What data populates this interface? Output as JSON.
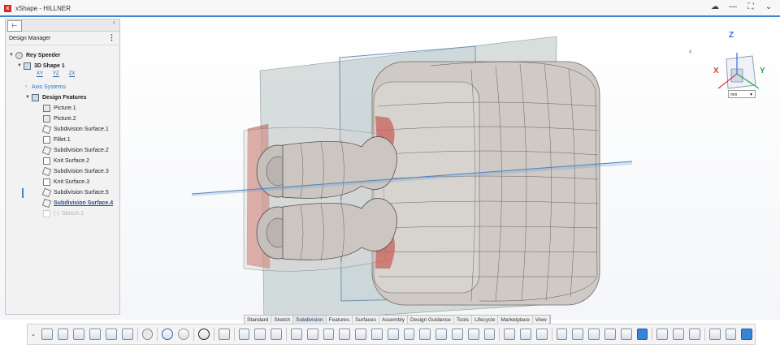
{
  "window": {
    "title": "xShape - HILLNER",
    "controls": {
      "cloud": "☁",
      "minimize": "—",
      "maximize": "⛶",
      "menu": "⌄"
    }
  },
  "panel": {
    "title": "Design Manager",
    "collapse_label": "‹",
    "menu_label": "⋮"
  },
  "tree": {
    "root": "Rey Speeder",
    "shape": "3D Shape 1",
    "small_icons": [
      "XY",
      "YZ",
      "ZX"
    ],
    "axis_systems": "Axis Systems",
    "design_features": "Design Features",
    "features": [
      {
        "label": "Picture.1",
        "icon": "picture-icon"
      },
      {
        "label": "Picture.2",
        "icon": "picture-icon"
      },
      {
        "label": "Subdivision Surface.1",
        "icon": "subdivision-icon"
      },
      {
        "label": "Fillet.1",
        "icon": "fillet-icon"
      },
      {
        "label": "Subdivision Surface.2",
        "icon": "subdivision-icon"
      },
      {
        "label": "Knit Surface.2",
        "icon": "knit-icon"
      },
      {
        "label": "Subdivision Surface.3",
        "icon": "subdivision-icon"
      },
      {
        "label": "Knit Surface.3",
        "icon": "knit-icon"
      },
      {
        "label": "Subdivision Surface.5",
        "icon": "subdivision-icon"
      },
      {
        "label": "Subdivision Surface.4",
        "icon": "subdivision-icon",
        "selected": true
      }
    ],
    "disabled_item": {
      "prefix": "(-)",
      "label": "Sketch.1"
    }
  },
  "viewport": {
    "collapse_label": "‹",
    "unit": "mm",
    "axes": {
      "x": "X",
      "y": "Y",
      "z": "Z"
    },
    "colors": {
      "body": "#cfcac5",
      "plane": "#a8b8b5",
      "accent": "#3c86d8",
      "red": "#c85850"
    }
  },
  "tabs": [
    {
      "label": "Standard"
    },
    {
      "label": "Sketch"
    },
    {
      "label": "Subdivision",
      "active": true
    },
    {
      "label": "Features"
    },
    {
      "label": "Surfaces"
    },
    {
      "label": "Assembly"
    },
    {
      "label": "Design Guidance"
    },
    {
      "label": "Tools"
    },
    {
      "label": "Lifecycle"
    },
    {
      "label": "Marketplace"
    },
    {
      "label": "View"
    }
  ],
  "toolbar_icons": [
    "new-icon",
    "open-icon",
    "save-icon",
    "save-as-icon",
    "rebuild-icon",
    "print-icon",
    "settings-icon",
    "undo-icon",
    "redo-icon",
    "help-icon",
    "sketch-icon",
    "box-icon",
    "grid-icon",
    "extrude-icon",
    "revolve-icon",
    "sweep-icon",
    "loft-icon",
    "fillet-icon",
    "chamfer-icon",
    "shell-icon",
    "draft-icon",
    "mirror-icon",
    "pattern-icon",
    "split-icon",
    "knit-icon",
    "thicken-icon",
    "boolean-icon",
    "measure-icon",
    "analyze-icon",
    "section-icon",
    "zoom-fit-icon",
    "zoom-icon",
    "pan-icon",
    "rotate-icon",
    "zoom-area-icon",
    "view-cube-icon",
    "display-icon",
    "appearance-icon",
    "render-icon",
    "compare-icon",
    "settings-view-icon",
    "active-view-icon"
  ]
}
